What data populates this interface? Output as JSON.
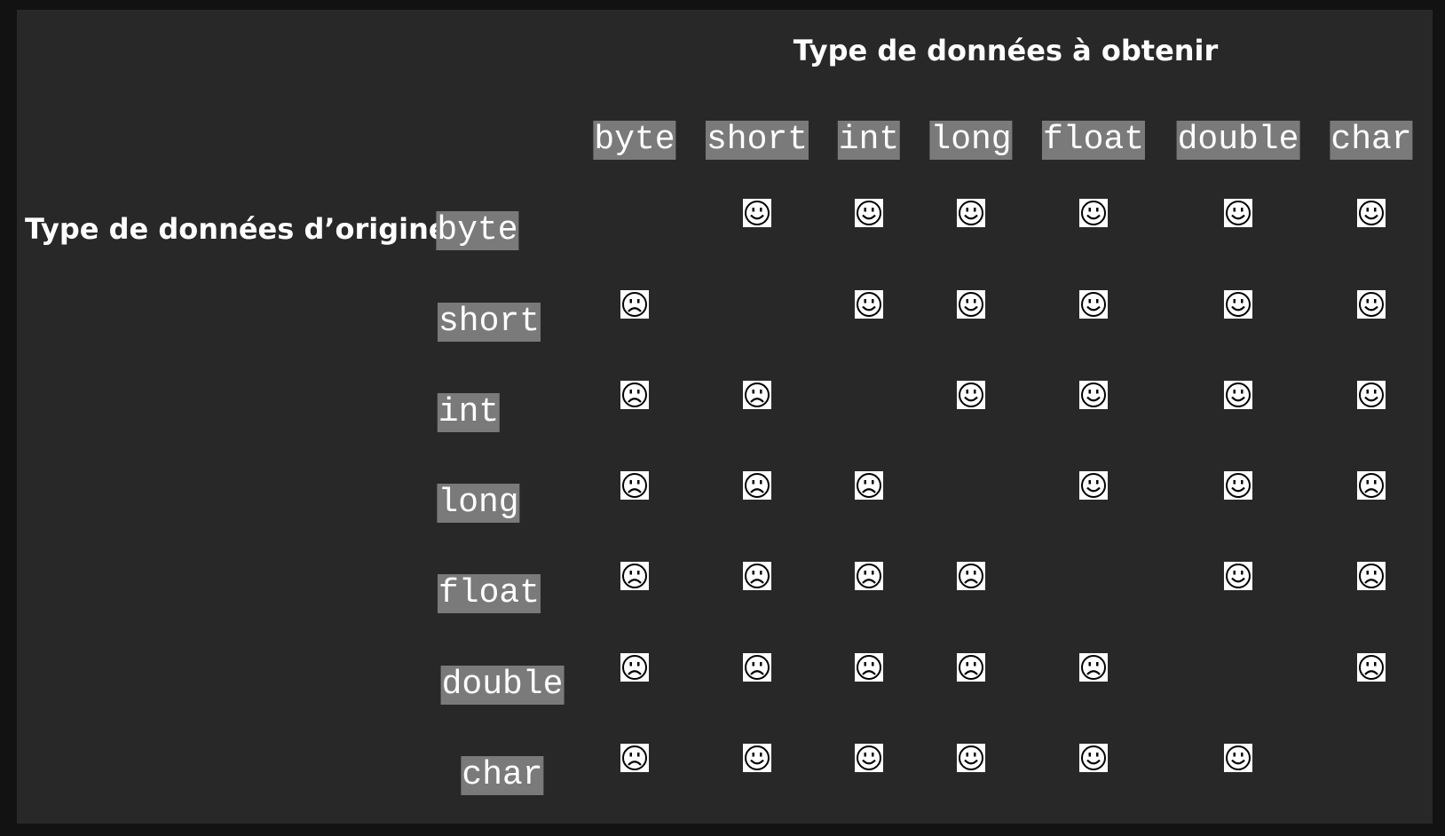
{
  "title_target": "Type de données à obtenir",
  "title_source": "Type de données d’origine",
  "target_types": [
    "byte",
    "short",
    "int",
    "long",
    "float",
    "double",
    "char"
  ],
  "source_types": [
    "byte",
    "short",
    "int",
    "long",
    "float",
    "double",
    "char"
  ],
  "matrix": [
    [
      "",
      "happy",
      "happy",
      "happy",
      "happy",
      "happy",
      "happy"
    ],
    [
      "sad",
      "",
      "happy",
      "happy",
      "happy",
      "happy",
      "happy"
    ],
    [
      "sad",
      "sad",
      "",
      "happy",
      "happy",
      "happy",
      "happy"
    ],
    [
      "sad",
      "sad",
      "sad",
      "",
      "happy",
      "happy",
      "sad"
    ],
    [
      "sad",
      "sad",
      "sad",
      "sad",
      "",
      "happy",
      "sad"
    ],
    [
      "sad",
      "sad",
      "sad",
      "sad",
      "sad",
      "",
      "sad"
    ],
    [
      "sad",
      "happy",
      "happy",
      "happy",
      "happy",
      "happy",
      ""
    ]
  ],
  "icons": {
    "happy": "smiley-face-icon",
    "sad": "sad-face-icon"
  },
  "colors": {
    "page_background": "#121212",
    "panel_background": "#282828",
    "label_background": "#7a7a7a",
    "text": "#ffffff",
    "icon_stroke": "#000000",
    "icon_background": "#ffffff"
  }
}
